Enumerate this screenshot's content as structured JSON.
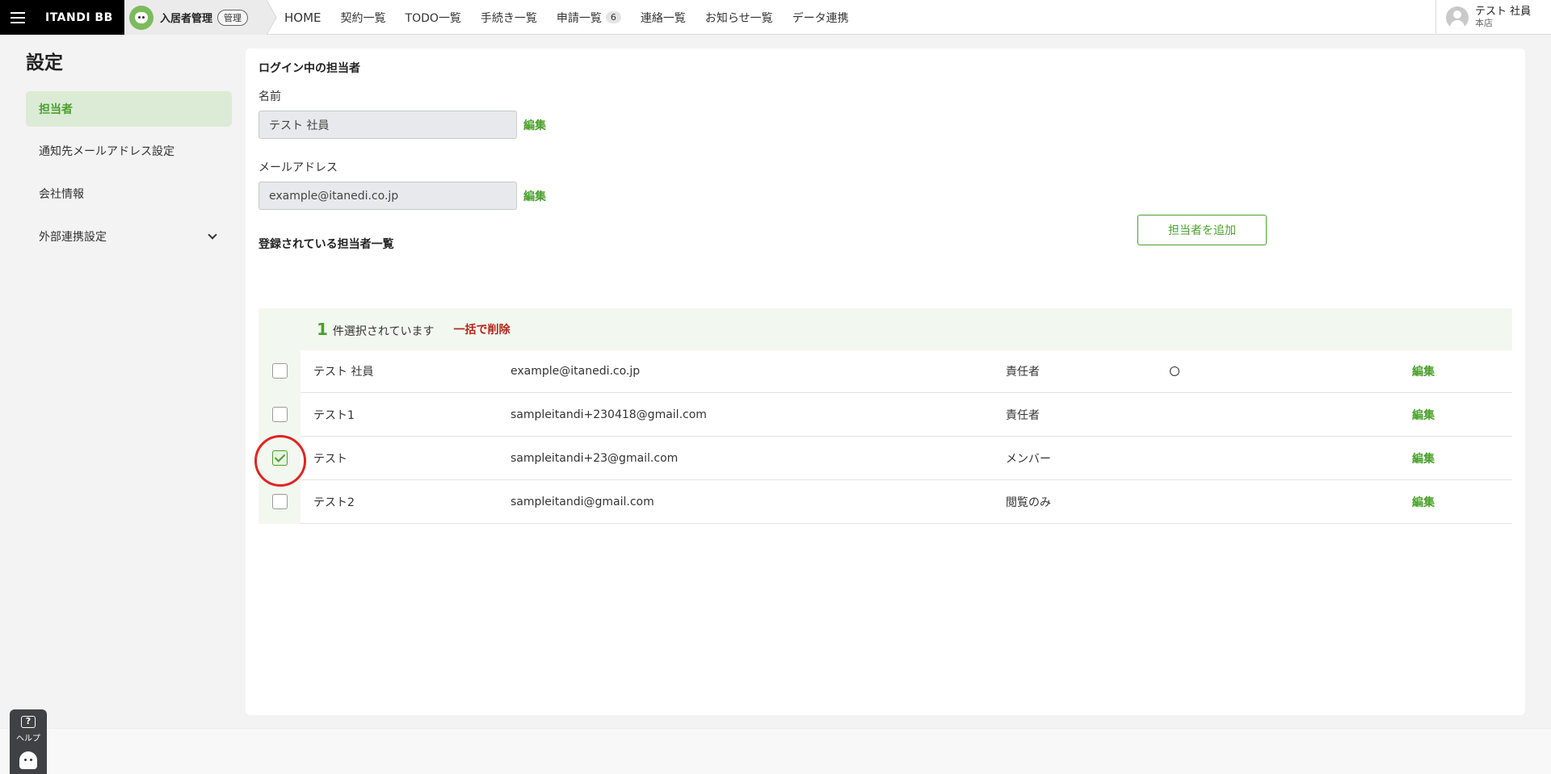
{
  "header": {
    "logo": "ITANDI BB",
    "product_name": "入居者管理",
    "admin_badge": "管理",
    "nav": [
      {
        "label": "HOME"
      },
      {
        "label": "契約一覧"
      },
      {
        "label": "TODO一覧"
      },
      {
        "label": "手続き一覧"
      },
      {
        "label": "申請一覧",
        "count": "6"
      },
      {
        "label": "連絡一覧"
      },
      {
        "label": "お知らせ一覧"
      },
      {
        "label": "データ連携"
      }
    ],
    "user": {
      "name": "テスト 社員",
      "branch": "本店"
    }
  },
  "sidebar": {
    "title": "設定",
    "items": [
      {
        "label": "担当者",
        "active": true
      },
      {
        "label": "通知先メールアドレス設定"
      },
      {
        "label": "会社情報"
      },
      {
        "label": "外部連携設定",
        "expandable": true
      }
    ]
  },
  "login_user": {
    "section_title": "ログイン中の担当者",
    "name_label": "名前",
    "name_value": "テスト 社員",
    "email_label": "メールアドレス",
    "email_value": "example@itanedi.co.jp",
    "edit_label": "編集"
  },
  "staff_list": {
    "section_title": "登録されている担当者一覧",
    "add_button": "担当者を追加",
    "selected_count": "1",
    "selected_text": "件選択されています",
    "bulk_delete": "一括で削除",
    "edit_label": "編集",
    "rows": [
      {
        "name": "テスト 社員",
        "email": "example@itanedi.co.jp",
        "role": "責任者",
        "primary": true,
        "checked": false
      },
      {
        "name": "テスト1",
        "email": "sampleitandi+230418@gmail.com",
        "role": "責任者",
        "primary": false,
        "checked": false
      },
      {
        "name": "テスト",
        "email": "sampleitandi+23@gmail.com",
        "role": "メンバー",
        "primary": false,
        "checked": true
      },
      {
        "name": "テスト2",
        "email": "sampleitandi@gmail.com",
        "role": "閲覧のみ",
        "primary": false,
        "checked": false
      }
    ]
  },
  "help": {
    "label": "ヘルプ",
    "icon_text": "?"
  },
  "colors": {
    "accent": "#4aa02c",
    "danger": "#b3261e",
    "highlight": "#e02424"
  }
}
